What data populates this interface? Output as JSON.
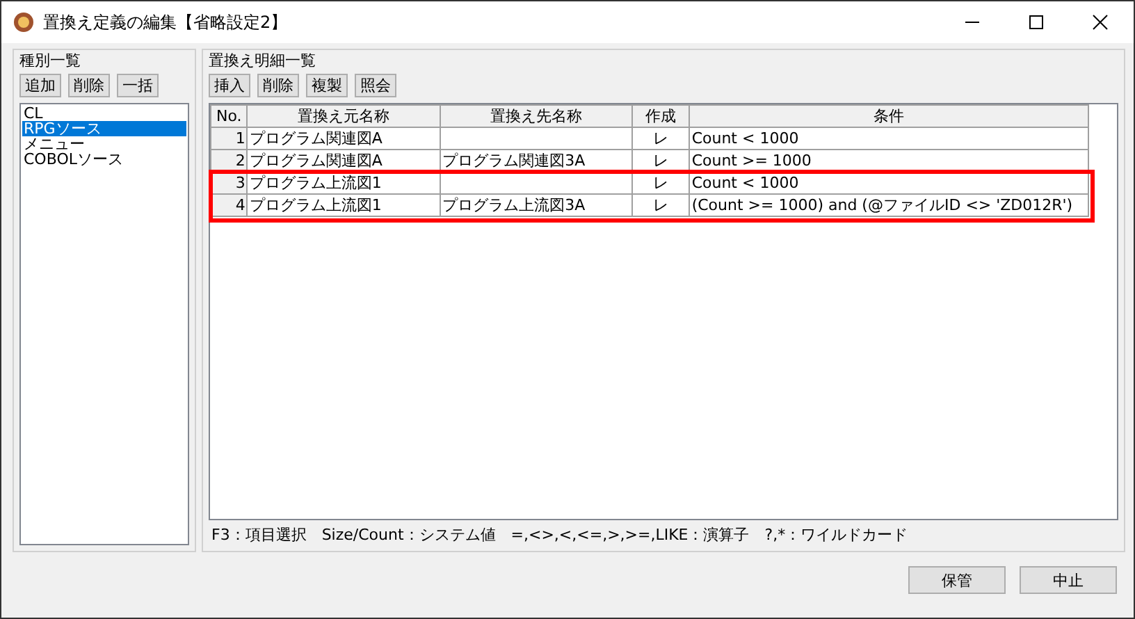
{
  "window": {
    "title": "置換え定義の編集【省略設定2】"
  },
  "type_panel": {
    "title": "種別一覧",
    "buttons": [
      "追加",
      "削除",
      "一括"
    ],
    "items": [
      {
        "label": "CL",
        "selected": false
      },
      {
        "label": "RPGソース",
        "selected": true
      },
      {
        "label": "メニュー",
        "selected": false
      },
      {
        "label": "COBOLソース",
        "selected": false
      }
    ]
  },
  "detail_panel": {
    "title": "置換え明細一覧",
    "buttons": [
      "挿入",
      "削除",
      "複製",
      "照会"
    ],
    "table": {
      "columns": [
        "No.",
        "置換え元名称",
        "置換え先名称",
        "作成",
        "条件"
      ],
      "rows": [
        {
          "cells": [
            "1",
            "プログラム関連図A",
            "",
            "レ",
            "Count < 1000"
          ],
          "annotated": false
        },
        {
          "cells": [
            "2",
            "プログラム関連図A",
            "プログラム関連図3A",
            "レ",
            "Count >= 1000"
          ],
          "annotated": false
        },
        {
          "cells": [
            "3",
            "プログラム上流図1",
            "",
            "レ",
            "Count < 1000"
          ],
          "annotated": true
        },
        {
          "cells": [
            "4",
            "プログラム上流図1",
            "プログラム上流図3A",
            "レ",
            "(Count >= 1000) and (@ファイルID <> 'ZD012R')"
          ],
          "annotated": true
        }
      ]
    },
    "hint": "F3：項目選択　Size/Count：システム値　=,<>,<,<=,>,>=,LIKE：演算子　?,*：ワイルドカード"
  },
  "footer_buttons": [
    "保管",
    "中止"
  ]
}
